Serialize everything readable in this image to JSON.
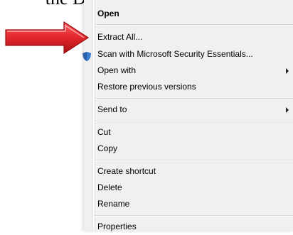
{
  "background": {
    "text": "the Desktop of your compu"
  },
  "context_menu": {
    "items": [
      {
        "label": "Open",
        "bold": true,
        "submenu": false
      },
      {
        "label": "Extract All...",
        "bold": false,
        "submenu": false
      },
      {
        "label": "Scan with Microsoft Security Essentials...",
        "bold": false,
        "submenu": false,
        "icon": "shield-icon"
      },
      {
        "label": "Open with",
        "bold": false,
        "submenu": true
      },
      {
        "label": "Restore previous versions",
        "bold": false,
        "submenu": false
      },
      {
        "label": "Send to",
        "bold": false,
        "submenu": true
      },
      {
        "label": "Cut",
        "bold": false,
        "submenu": false
      },
      {
        "label": "Copy",
        "bold": false,
        "submenu": false
      },
      {
        "label": "Create shortcut",
        "bold": false,
        "submenu": false
      },
      {
        "label": "Delete",
        "bold": false,
        "submenu": false
      },
      {
        "label": "Rename",
        "bold": false,
        "submenu": false
      },
      {
        "label": "Properties",
        "bold": false,
        "submenu": false
      }
    ]
  },
  "annotation": {
    "icon": "red-arrow-icon",
    "color": "#e3262b"
  }
}
